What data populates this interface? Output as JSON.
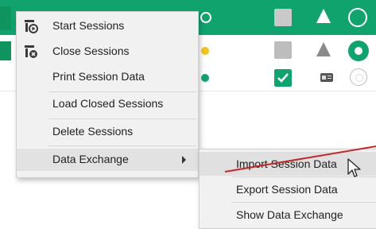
{
  "menu": {
    "items": [
      {
        "label": "Start Sessions",
        "icon": "start-sessions-icon"
      },
      {
        "label": "Close Sessions",
        "icon": "close-sessions-icon"
      },
      {
        "label": "Print Session Data"
      },
      {
        "label": "Load Closed Sessions"
      },
      {
        "label": "Delete Sessions"
      },
      {
        "label": "Data Exchange",
        "has_submenu": true,
        "highlighted": true
      }
    ]
  },
  "submenu": {
    "items": [
      {
        "label": "Import Session Data",
        "highlighted": true
      },
      {
        "label": "Export Session Data"
      },
      {
        "label": "Show Data Exchange"
      }
    ]
  },
  "colors": {
    "row_selected": "#11a36e",
    "status_green": "#11a36e",
    "status_yellow": "#f4c21a",
    "warning_gray": "#8a8a8a",
    "annotation_line": "#c0282b"
  }
}
